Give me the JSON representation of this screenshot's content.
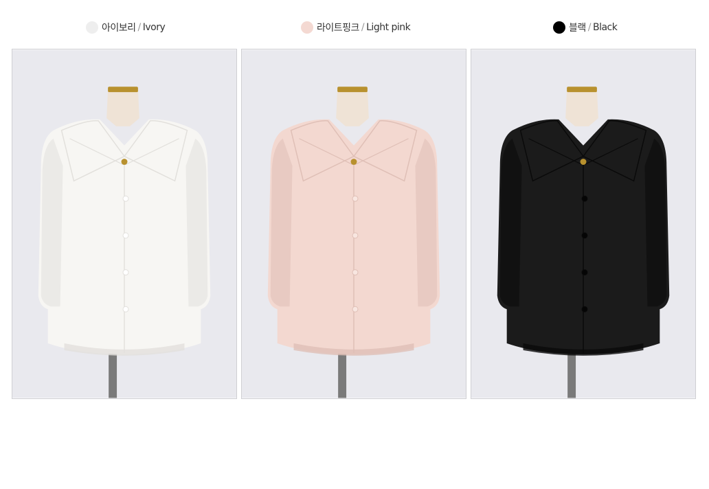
{
  "colors": [
    {
      "ko": "아이보리",
      "separator": "/",
      "en": "Ivory",
      "swatch": "#eeeeee",
      "fabric": "#f7f6f3",
      "shade": "#e2e0dc",
      "button": "#ffffff"
    },
    {
      "ko": "라이트핑크",
      "separator": "/",
      "en": "Light pink",
      "swatch": "#f4d9d2",
      "fabric": "#f3d8d0",
      "shade": "#dfbfb6",
      "button": "#f8e6e0"
    },
    {
      "ko": "블랙",
      "separator": "/",
      "en": "Black",
      "swatch": "#000000",
      "fabric": "#1b1b1b",
      "shade": "#0a0a0a",
      "button": "#050505"
    }
  ],
  "background": "#e9e9ee",
  "mannequin": "#efe3d6",
  "brass": "#b8912e"
}
